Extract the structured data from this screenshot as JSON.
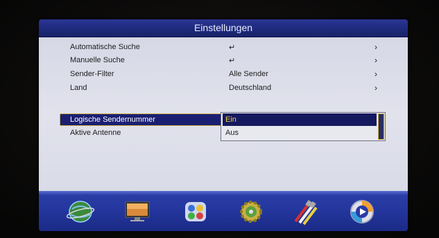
{
  "header": {
    "title": "Einstellungen"
  },
  "menu": {
    "items": [
      {
        "label": "Automatische Suche",
        "value": "↵",
        "arrow": "›"
      },
      {
        "label": "Manuelle Suche",
        "value": "↵",
        "arrow": "›"
      },
      {
        "label": "Sender-Filter",
        "value": "Alle Sender",
        "arrow": "›"
      },
      {
        "label": "Land",
        "value": "Deutschland",
        "arrow": "›"
      },
      {
        "label": "Logische Sendernummer"
      },
      {
        "label": "Aktive Antenne"
      }
    ]
  },
  "dropdown": {
    "options": [
      "Ein",
      "Aus"
    ],
    "selected": "Ein"
  },
  "toolbar": {
    "icons": [
      "satellite-globe-icon",
      "tv-screen-icon",
      "apps-icon",
      "gear-icon",
      "av-cables-icon",
      "media-play-icon"
    ]
  },
  "colors": {
    "title_bar": "#1e2a7c",
    "menu_bg": "#dcdde8",
    "highlight": "#1a1f72",
    "highlight_border": "#c9a93a",
    "selected_text": "#f4d23a",
    "icon_bar": "#2538a0"
  }
}
